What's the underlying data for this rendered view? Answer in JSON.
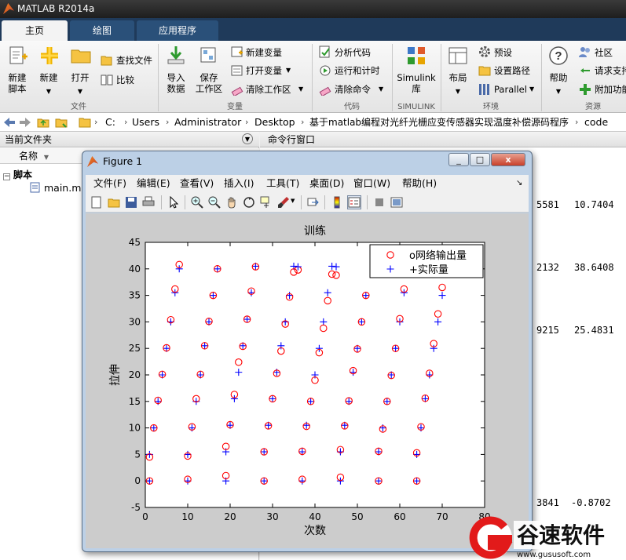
{
  "window_title": "MATLAB R2014a",
  "tabs": [
    {
      "label": "主页",
      "active": true
    },
    {
      "label": "绘图",
      "active": false
    },
    {
      "label": "应用程序",
      "active": false
    }
  ],
  "ribbon": {
    "file": {
      "new_script": "新建\n脚本",
      "new": "新建",
      "open": "打开",
      "find_files": "查找文件",
      "compare": "比较",
      "group_label": "文件"
    },
    "variable": {
      "import_data": "导入\n数据",
      "save_workspace": "保存\n工作区",
      "new_variable": "新建变量",
      "open_variable": "打开变量",
      "clear_workspace": "清除工作区",
      "group_label": "变量"
    },
    "code": {
      "analyze_code": "分析代码",
      "run_and_time": "运行和计时",
      "clear_commands": "清除命令",
      "group_label": "代码"
    },
    "simulink": {
      "library": "Simulink\n库",
      "group_label": "SIMULINK"
    },
    "environment": {
      "layout": "布局",
      "preferences": "预设",
      "set_path": "设置路径",
      "parallel": "Parallel",
      "group_label": "环境"
    },
    "resources": {
      "help": "帮助",
      "community": "社区",
      "request_support": "请求支持",
      "addons": "附加功能",
      "group_label": "资源"
    }
  },
  "address_bar": {
    "path": [
      "C:",
      "Users",
      "Administrator",
      "Desktop",
      "基于matlab编程对光纤光栅应变传感器实现温度补偿源码程序",
      "code"
    ]
  },
  "current_folder": {
    "title": "当前文件夹",
    "column_name": "名称",
    "group": "脚本",
    "files": [
      "main.m"
    ]
  },
  "command_window": {
    "title": "命令行窗口",
    "visible_values": [
      "5581",
      "10.7404",
      "2132",
      "38.6408",
      "9215",
      "25.4831",
      "3841",
      "-0.8702"
    ]
  },
  "figure": {
    "title": "Figure 1",
    "menu": [
      "文件(F)",
      "编辑(E)",
      "查看(V)",
      "插入(I)",
      "工具(T)",
      "桌面(D)",
      "窗口(W)",
      "帮助(H)"
    ],
    "window_buttons": [
      "_",
      "□",
      "x"
    ]
  },
  "colors": {
    "predicted_marker": "#ff0000",
    "actual_marker": "#0000ff",
    "plot_bg": "#ffffff",
    "figure_bg": "#cccccc"
  },
  "chart_data": {
    "type": "scatter",
    "title": "训练",
    "xlabel": "次数",
    "ylabel": "拉伸",
    "xlim": [
      0,
      80
    ],
    "ylim": [
      -5,
      45
    ],
    "xticks": [
      0,
      10,
      20,
      30,
      40,
      50,
      60,
      70,
      80
    ],
    "yticks": [
      -5,
      0,
      5,
      10,
      15,
      20,
      25,
      30,
      35,
      40,
      45
    ],
    "legend_position": "top-right",
    "series": [
      {
        "name": "o网络输出量",
        "marker": "circle",
        "x": [
          1,
          10,
          19,
          28,
          37,
          46,
          55,
          64,
          1,
          10,
          19,
          28,
          37,
          46,
          55,
          64,
          2,
          11,
          20,
          29,
          38,
          47,
          56,
          65,
          3,
          12,
          21,
          30,
          39,
          48,
          57,
          66,
          4,
          13,
          22,
          31,
          40,
          49,
          58,
          67,
          5,
          14,
          23,
          32,
          41,
          50,
          59,
          68,
          6,
          15,
          24,
          33,
          42,
          51,
          60,
          69,
          7,
          16,
          25,
          34,
          43,
          52,
          61,
          70,
          8,
          17,
          26,
          35,
          44,
          53,
          62,
          71
        ],
        "y": [
          0,
          0.3,
          1,
          0,
          0.3,
          0.7,
          0,
          0,
          4.5,
          4.7,
          6.5,
          5.5,
          5.6,
          5.9,
          5.6,
          5.3,
          10,
          10.2,
          10.6,
          10.4,
          10.3,
          10.4,
          9.8,
          10.2,
          15.2,
          15.5,
          16.3,
          15.5,
          15,
          15.1,
          15,
          15.6,
          20.1,
          20.1,
          22.4,
          20.3,
          19,
          20.8,
          19.9,
          20.3,
          25.1,
          25.5,
          25.4,
          24.5,
          24.2,
          24.9,
          25,
          25.9,
          30.4,
          30.1,
          30.5,
          29.6,
          28.8,
          30,
          30.6,
          31.5,
          36.2,
          35,
          35.8,
          34.7,
          34,
          35,
          36.2,
          36.5,
          40.8,
          40,
          40.4,
          39.4,
          39,
          null,
          null,
          null
        ]
      },
      {
        "name": "+实际量",
        "marker": "plus",
        "x": [
          1,
          10,
          19,
          28,
          37,
          46,
          55,
          64,
          1,
          10,
          19,
          28,
          37,
          46,
          55,
          64,
          2,
          11,
          20,
          29,
          38,
          47,
          56,
          65,
          3,
          12,
          21,
          30,
          39,
          48,
          57,
          66,
          4,
          13,
          22,
          31,
          40,
          49,
          58,
          67,
          5,
          14,
          23,
          32,
          41,
          50,
          59,
          68,
          6,
          15,
          24,
          33,
          42,
          51,
          60,
          69,
          7,
          16,
          25,
          34,
          43,
          52,
          61,
          70,
          8,
          17,
          26,
          35,
          44,
          53,
          62,
          71
        ],
        "y": [
          0,
          0,
          0,
          0,
          0,
          0,
          0,
          0,
          5,
          5,
          5.5,
          5.5,
          5.5,
          5.5,
          5.5,
          5,
          10,
          10,
          10.5,
          10.5,
          10.5,
          10.5,
          10,
          10,
          15,
          15,
          15.5,
          15.5,
          15,
          15,
          15,
          15.5,
          20,
          20,
          20.5,
          20.5,
          20,
          20.5,
          20,
          20,
          25,
          25.5,
          25.5,
          25.5,
          25,
          25,
          25,
          25,
          30,
          30,
          30.5,
          30,
          30,
          30,
          30,
          30,
          35.5,
          35,
          35.5,
          35,
          35.5,
          35,
          35.5,
          35,
          40,
          40,
          40.5,
          40.5,
          40.5,
          null,
          null,
          null
        ]
      }
    ]
  }
}
